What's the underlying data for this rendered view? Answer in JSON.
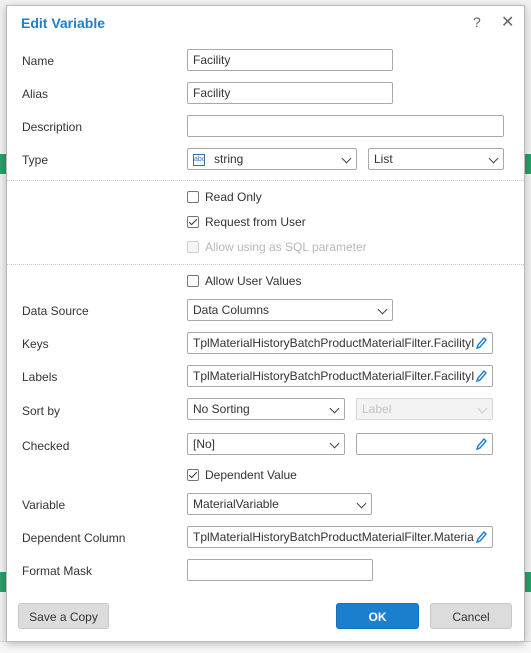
{
  "dialog": {
    "title": "Edit Variable",
    "help_icon": "question-mark-icon",
    "close_icon": "close-icon"
  },
  "fields": {
    "name": {
      "label": "Name",
      "value": "Facility"
    },
    "alias": {
      "label": "Alias",
      "value": "Facility"
    },
    "description": {
      "label": "Description",
      "value": ""
    },
    "type": {
      "label": "Type",
      "type_icon": "abc-string-icon",
      "type_value": "string",
      "kind_value": "List"
    }
  },
  "checkboxes": {
    "read_only": {
      "label": "Read Only",
      "checked": false
    },
    "request_from_user": {
      "label": "Request from User",
      "checked": true
    },
    "allow_sql": {
      "label": "Allow using as SQL parameter",
      "checked": false,
      "disabled": true
    },
    "allow_user_values": {
      "label": "Allow User Values",
      "checked": false
    },
    "dependent_value": {
      "label": "Dependent Value",
      "checked": true
    }
  },
  "data": {
    "data_source": {
      "label": "Data Source",
      "value": "Data Columns"
    },
    "keys": {
      "label": "Keys",
      "value": "TplMaterialHistoryBatchProductMaterialFilter.FacilityI"
    },
    "labels": {
      "label": "Labels",
      "value": "TplMaterialHistoryBatchProductMaterialFilter.FacilityI"
    },
    "sort_by": {
      "label": "Sort by",
      "value": "No Sorting",
      "secondary_placeholder": "Label"
    },
    "checked": {
      "label": "Checked",
      "value": "[No]",
      "secondary_value": ""
    },
    "variable": {
      "label": "Variable",
      "value": "MaterialVariable"
    },
    "dependent_column": {
      "label": "Dependent Column",
      "value": "TplMaterialHistoryBatchProductMaterialFilter.Materia"
    },
    "format_mask": {
      "label": "Format Mask",
      "value": ""
    }
  },
  "buttons": {
    "save_copy": "Save a Copy",
    "ok": "OK",
    "cancel": "Cancel"
  },
  "colors": {
    "title": "#1f7fc8",
    "primary": "#1b7fd0",
    "background_green": "#27a06a"
  }
}
